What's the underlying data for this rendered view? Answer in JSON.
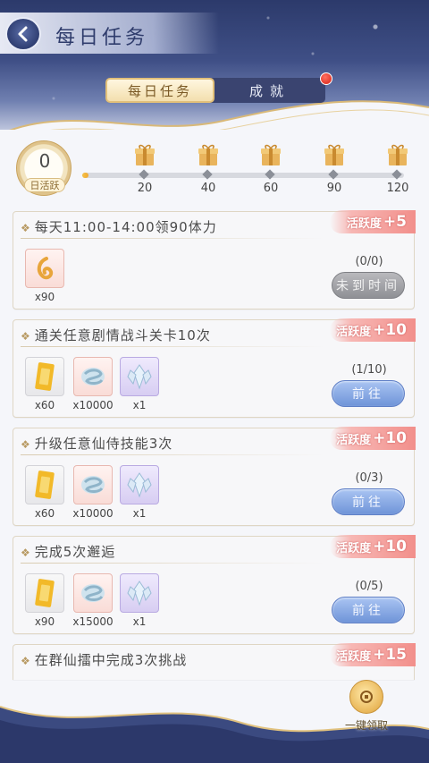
{
  "header": {
    "title": "每日任务",
    "back_icon": "back-arrow-icon"
  },
  "tabs": [
    {
      "label": "每日任务",
      "active": true
    },
    {
      "label": "成就",
      "active": false,
      "notification": true
    }
  ],
  "activity": {
    "value": "0",
    "label": "日活跃",
    "progress_fraction": 0,
    "milestones": [
      "20",
      "40",
      "60",
      "90",
      "120"
    ]
  },
  "tasks": [
    {
      "title": "每天11:00-14:00领90体力",
      "badge_label": "活跃度",
      "badge_value": "+5",
      "rewards": [
        {
          "icon": "stamina-icon",
          "qty": "x90",
          "rarity": "red"
        }
      ],
      "progress": "(0/0)",
      "button": "未到时间",
      "button_state": "disabled"
    },
    {
      "title": "通关任意剧情战斗关卡10次",
      "badge_label": "活跃度",
      "badge_value": "+10",
      "rewards": [
        {
          "icon": "gold-ticket-icon",
          "qty": "x60",
          "rarity": "gray"
        },
        {
          "icon": "silver-coin-icon",
          "qty": "x10000",
          "rarity": "red"
        },
        {
          "icon": "crystal-icon",
          "qty": "x1",
          "rarity": "purple"
        }
      ],
      "progress": "(1/10)",
      "button": "前往",
      "button_state": "go"
    },
    {
      "title": "升级任意仙侍技能3次",
      "badge_label": "活跃度",
      "badge_value": "+10",
      "rewards": [
        {
          "icon": "gold-ticket-icon",
          "qty": "x60",
          "rarity": "gray"
        },
        {
          "icon": "silver-coin-icon",
          "qty": "x10000",
          "rarity": "red"
        },
        {
          "icon": "crystal-icon",
          "qty": "x1",
          "rarity": "purple"
        }
      ],
      "progress": "(0/3)",
      "button": "前往",
      "button_state": "go"
    },
    {
      "title": "完成5次邂逅",
      "badge_label": "活跃度",
      "badge_value": "+10",
      "rewards": [
        {
          "icon": "gold-ticket-icon",
          "qty": "x90",
          "rarity": "gray"
        },
        {
          "icon": "silver-coin-icon",
          "qty": "x15000",
          "rarity": "red"
        },
        {
          "icon": "crystal-icon",
          "qty": "x1",
          "rarity": "purple"
        }
      ],
      "progress": "(0/5)",
      "button": "前往",
      "button_state": "go"
    },
    {
      "title": "在群仙擂中完成3次挑战",
      "badge_label": "活跃度",
      "badge_value": "+15",
      "rewards": [],
      "progress": "",
      "button": "",
      "button_state": "hidden"
    }
  ],
  "claim_all": {
    "label": "一键领取",
    "icon": "money-bag-icon"
  }
}
